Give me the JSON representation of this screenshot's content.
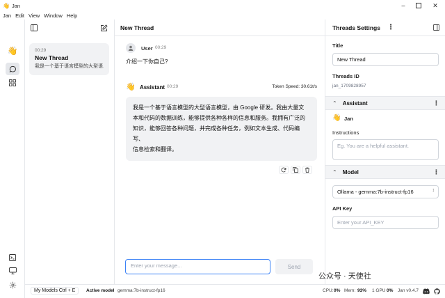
{
  "window": {
    "title": "Jan",
    "app_icon": "👋"
  },
  "menu": [
    "Jan",
    "Edit",
    "View",
    "Window",
    "Help"
  ],
  "thread_list": {
    "item": {
      "time": "00:29",
      "title": "New Thread",
      "preview": "我是一个基于语言模型的大型语..."
    }
  },
  "main": {
    "header_title": "New Thread",
    "user": {
      "name": "User",
      "time": "00:29",
      "text": "介绍一下你自己?"
    },
    "assistant": {
      "avatar": "👋",
      "name": "Assistant",
      "time": "00:29",
      "token_speed": "Token Speed: 30.61t/s",
      "lines": [
        "我是一个基于语言模型的大型语言模型，由 Google 研发。我由大量文",
        "本和代码的数据训练，能够提供各种各样的信息和服务。我拥有广泛的",
        "知识，能够回答各种问题，并完成各种任务，例如文本生成、代码编写、",
        "信息检索和翻译。"
      ]
    },
    "composer_placeholder": "Enter your message...",
    "send_label": "Send"
  },
  "settings": {
    "header": "Threads Settings",
    "title_label": "Title",
    "title_value": "New Thread",
    "thread_id_label": "Threads ID",
    "thread_id_value": "jan_1709828957",
    "assistant_section": "Assistant",
    "assistant_avatar": "👋",
    "assistant_name": "Jan",
    "instructions_label": "Instructions",
    "instructions_placeholder": "Eg. You are a helpful assistant.",
    "model_section": "Model",
    "model_value": "Ollama - gemma:7b-instruct-fp16",
    "api_key_label": "API Key",
    "api_key_placeholder": "Enter your API_KEY"
  },
  "footer": {
    "my_models": "My Models Ctrl + E",
    "active_model_label": "Active model",
    "active_model_value": "gemma:7b-instruct-fp16",
    "cpu_label": "CPU:",
    "cpu_value": "0%",
    "mem_label": "Mem:",
    "mem_value": "93%",
    "gpu_label": "1 GPU",
    "gpu_value": "0%",
    "version": "Jan v0.4.7"
  },
  "watermark": "公众号 · 天使社"
}
